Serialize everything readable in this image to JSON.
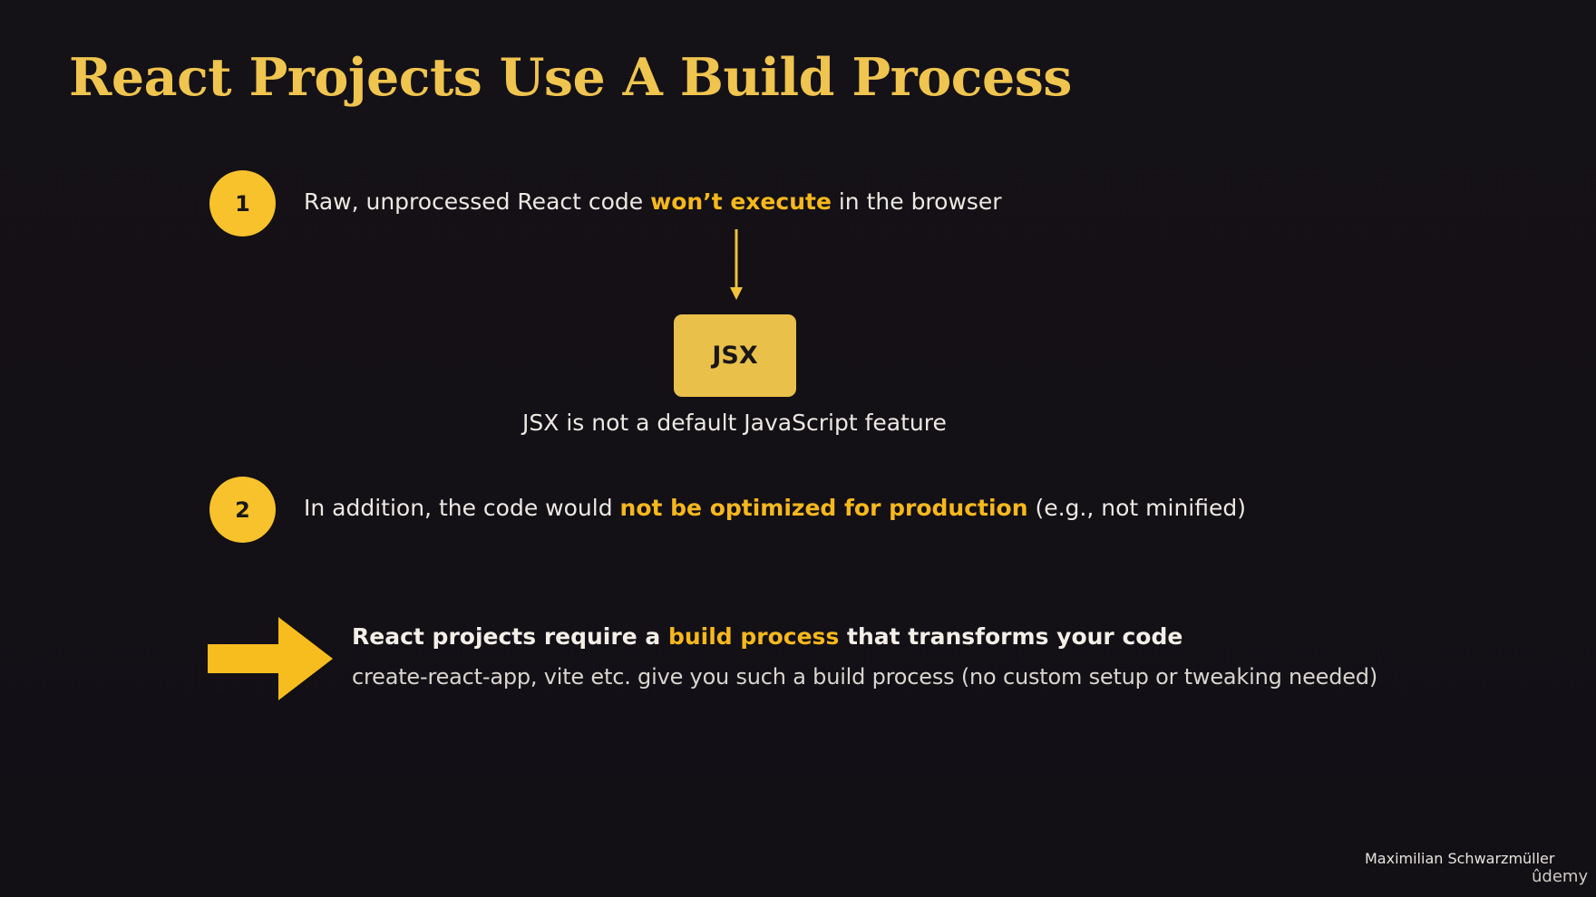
{
  "title": "React Projects Use A Build Process",
  "point1": {
    "number": "1",
    "text_before": "Raw, unprocessed React code ",
    "highlight": "won’t execute",
    "text_after": " in the browser"
  },
  "jsx": {
    "box_label": "JSX",
    "caption": "JSX is not a default JavaScript feature"
  },
  "point2": {
    "number": "2",
    "text_before": "In addition, the code would ",
    "highlight": "not be optimized for production",
    "text_after": " (e.g., not minified)"
  },
  "conclusion": {
    "text_before": "React projects require a ",
    "highlight": "build process",
    "text_after": " that transforms your code",
    "subtext": "create-react-app, vite etc. give you such a build process (no custom setup or tweaking needed)"
  },
  "footer": {
    "author": "Maximilian Schwarzmüller",
    "brand": "ûdemy"
  },
  "colors": {
    "background": "#131017",
    "accent": "#f7c22b",
    "title": "#efc44f",
    "highlight": "#f7b81d",
    "jsx_box": "#e9c04a"
  }
}
